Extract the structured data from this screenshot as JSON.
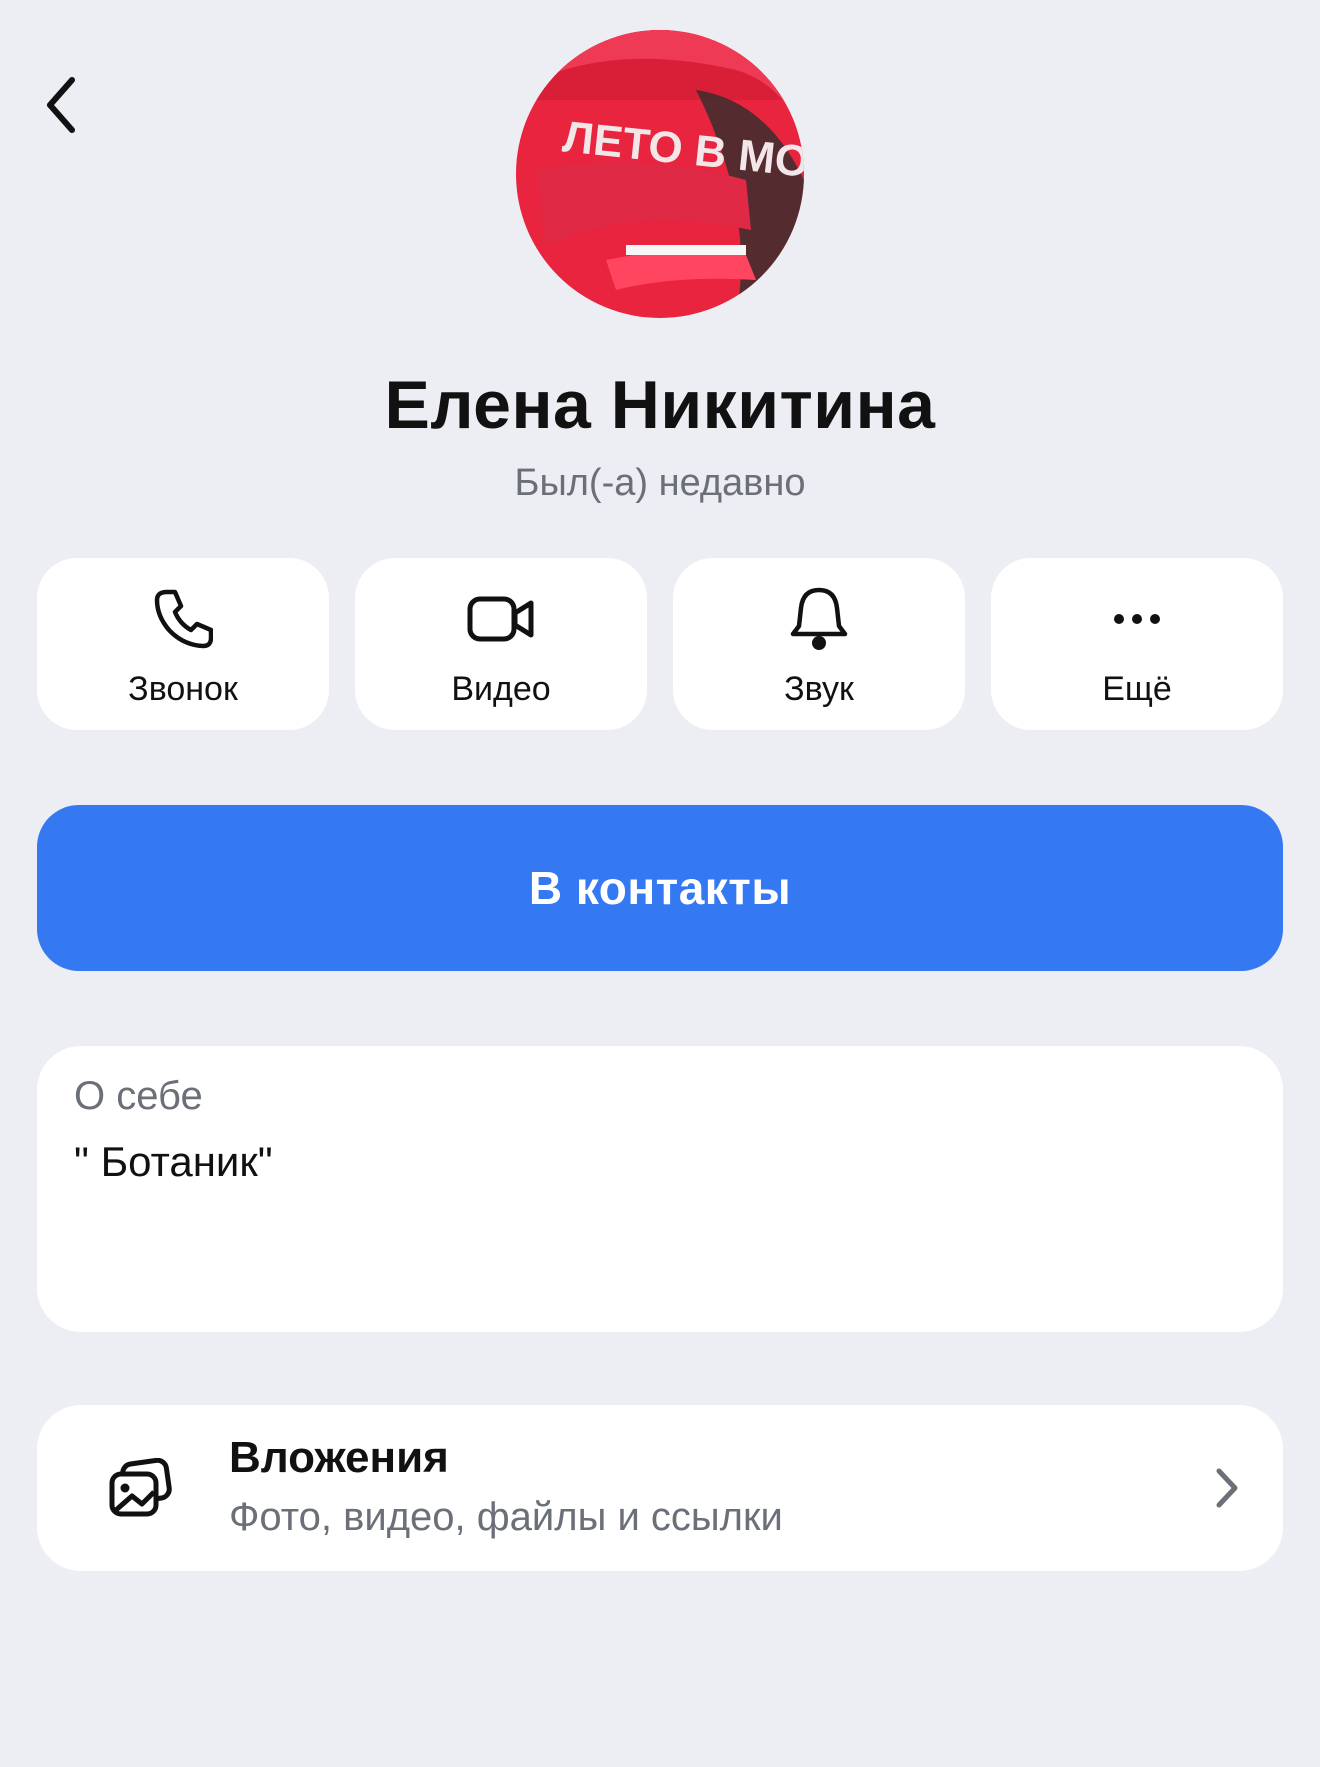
{
  "profile": {
    "name": "Елена Никитина",
    "status": "Был(-а) недавно",
    "avatar_caption": "ЛЕТО В МОСКВЕ"
  },
  "actions": [
    {
      "label": "Звонок",
      "icon": "phone-icon"
    },
    {
      "label": "Видео",
      "icon": "video-camera-icon"
    },
    {
      "label": "Звук",
      "icon": "bell-icon"
    },
    {
      "label": "Ещё",
      "icon": "more-icon"
    }
  ],
  "primary_button": {
    "label": "В контакты"
  },
  "about": {
    "title": "О себе",
    "text": "\" Ботаник\""
  },
  "attachments": {
    "title": "Вложения",
    "subtitle": "Фото, видео, файлы и ссылки",
    "icon": "gallery-icon"
  },
  "colors": {
    "background": "#eceef3",
    "card": "#ffffff",
    "accent": "#3478f2",
    "secondary_text": "#6b6f78"
  }
}
